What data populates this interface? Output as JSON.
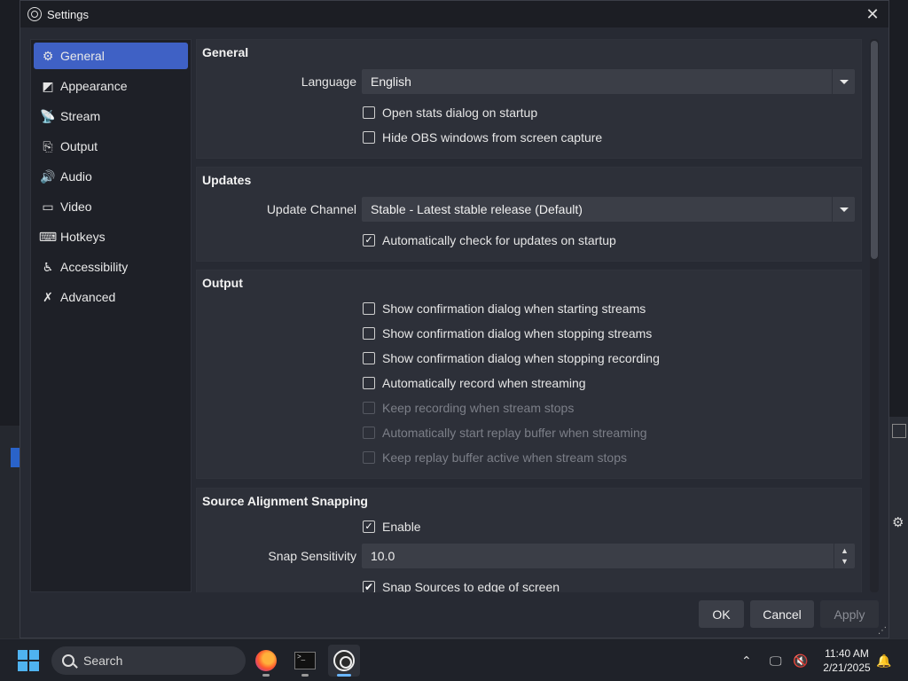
{
  "window": {
    "title": "Settings"
  },
  "sidebar": {
    "items": [
      {
        "label": "General",
        "icon": "gear-icon",
        "active": true
      },
      {
        "label": "Appearance",
        "icon": "appearance-icon"
      },
      {
        "label": "Stream",
        "icon": "antenna-icon"
      },
      {
        "label": "Output",
        "icon": "monitor-output-icon"
      },
      {
        "label": "Audio",
        "icon": "speaker-icon"
      },
      {
        "label": "Video",
        "icon": "display-icon"
      },
      {
        "label": "Hotkeys",
        "icon": "keyboard-icon"
      },
      {
        "label": "Accessibility",
        "icon": "accessibility-icon"
      },
      {
        "label": "Advanced",
        "icon": "wrench-icon"
      }
    ]
  },
  "general": {
    "title": "General",
    "language_label": "Language",
    "language_value": "English",
    "open_stats": {
      "label": "Open stats dialog on startup",
      "checked": false
    },
    "hide_obs": {
      "label": "Hide OBS windows from screen capture",
      "checked": false
    }
  },
  "updates": {
    "title": "Updates",
    "channel_label": "Update Channel",
    "channel_value": "Stable - Latest stable release (Default)",
    "auto_check": {
      "label": "Automatically check for updates on startup",
      "checked": true
    }
  },
  "output": {
    "title": "Output",
    "options": [
      {
        "label": "Show confirmation dialog when starting streams",
        "checked": false,
        "enabled": true
      },
      {
        "label": "Show confirmation dialog when stopping streams",
        "checked": false,
        "enabled": true
      },
      {
        "label": "Show confirmation dialog when stopping recording",
        "checked": false,
        "enabled": true
      },
      {
        "label": "Automatically record when streaming",
        "checked": false,
        "enabled": true
      },
      {
        "label": "Keep recording when stream stops",
        "checked": false,
        "enabled": false
      },
      {
        "label": "Automatically start replay buffer when streaming",
        "checked": false,
        "enabled": false
      },
      {
        "label": "Keep replay buffer active when stream stops",
        "checked": false,
        "enabled": false
      }
    ]
  },
  "snapping": {
    "title": "Source Alignment Snapping",
    "enable": {
      "label": "Enable",
      "checked": true
    },
    "sensitivity_label": "Snap Sensitivity",
    "sensitivity_value": "10.0",
    "snap_edge": {
      "label": "Snap Sources to edge of screen",
      "checked": true
    }
  },
  "footer": {
    "ok": "OK",
    "cancel": "Cancel",
    "apply": "Apply"
  },
  "taskbar": {
    "search_placeholder": "Search",
    "time": "11:40 AM",
    "date": "2/21/2025"
  },
  "colors": {
    "accent": "#3f61c5",
    "dialog_bg": "#272a33",
    "group_bg": "#2d3039"
  }
}
